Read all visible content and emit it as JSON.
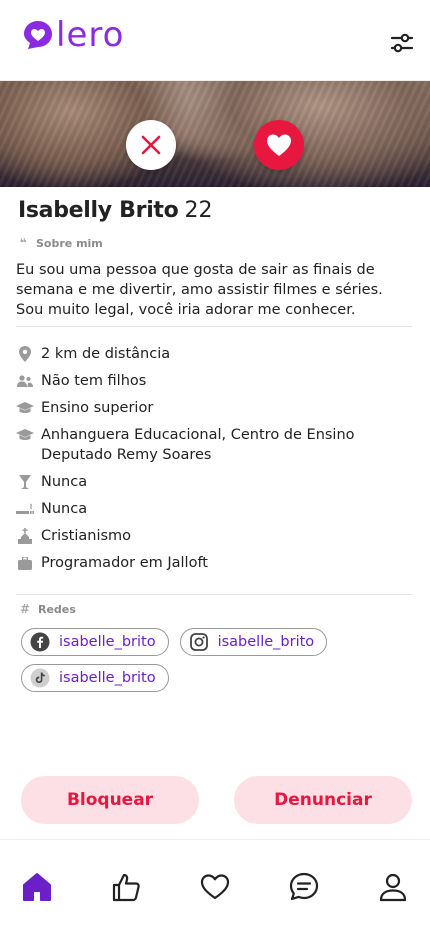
{
  "app": {
    "logo_text": "lero",
    "brand_color": "#8a2be2",
    "accent_color": "#e8173f"
  },
  "header": {
    "filter_icon": "sliders-icon"
  },
  "profile": {
    "name": "Isabelly Brito",
    "age": "22",
    "about_label": "Sobre mim",
    "about_text": "Eu sou uma pessoa que gosta de sair as finais de semana e me divertir, amo assistir filmes e séries. Sou muito legal, você iria adorar me conhecer.",
    "details": [
      {
        "icon": "location-pin-icon",
        "text": "2 km de distância"
      },
      {
        "icon": "children-icon",
        "text": "Não tem filhos"
      },
      {
        "icon": "graduation-cap-icon",
        "text": "Ensino superior"
      },
      {
        "icon": "graduation-cap-icon",
        "text": "Anhanguera Educacional, Centro de Ensino Deputado Remy Soares"
      },
      {
        "icon": "drink-icon",
        "text": "Nunca"
      },
      {
        "icon": "smoking-icon",
        "text": "Nunca"
      },
      {
        "icon": "church-icon",
        "text": "Cristianismo"
      },
      {
        "icon": "briefcase-icon",
        "text": "Programador em Jalloft"
      }
    ],
    "networks_label": "Redes",
    "networks": [
      {
        "icon": "facebook-icon",
        "handle": "isabelle_brito"
      },
      {
        "icon": "instagram-icon",
        "handle": "isabelle_brito"
      },
      {
        "icon": "tiktok-icon",
        "handle": "isabelle_brito"
      }
    ]
  },
  "actions": {
    "block_label": "Bloquear",
    "report_label": "Denunciar"
  },
  "tabbar": {
    "items": [
      {
        "icon": "home-icon",
        "active": true
      },
      {
        "icon": "thumbs-up-icon",
        "active": false
      },
      {
        "icon": "heart-icon",
        "active": false
      },
      {
        "icon": "chat-icon",
        "active": false
      },
      {
        "icon": "profile-icon",
        "active": false
      }
    ]
  }
}
